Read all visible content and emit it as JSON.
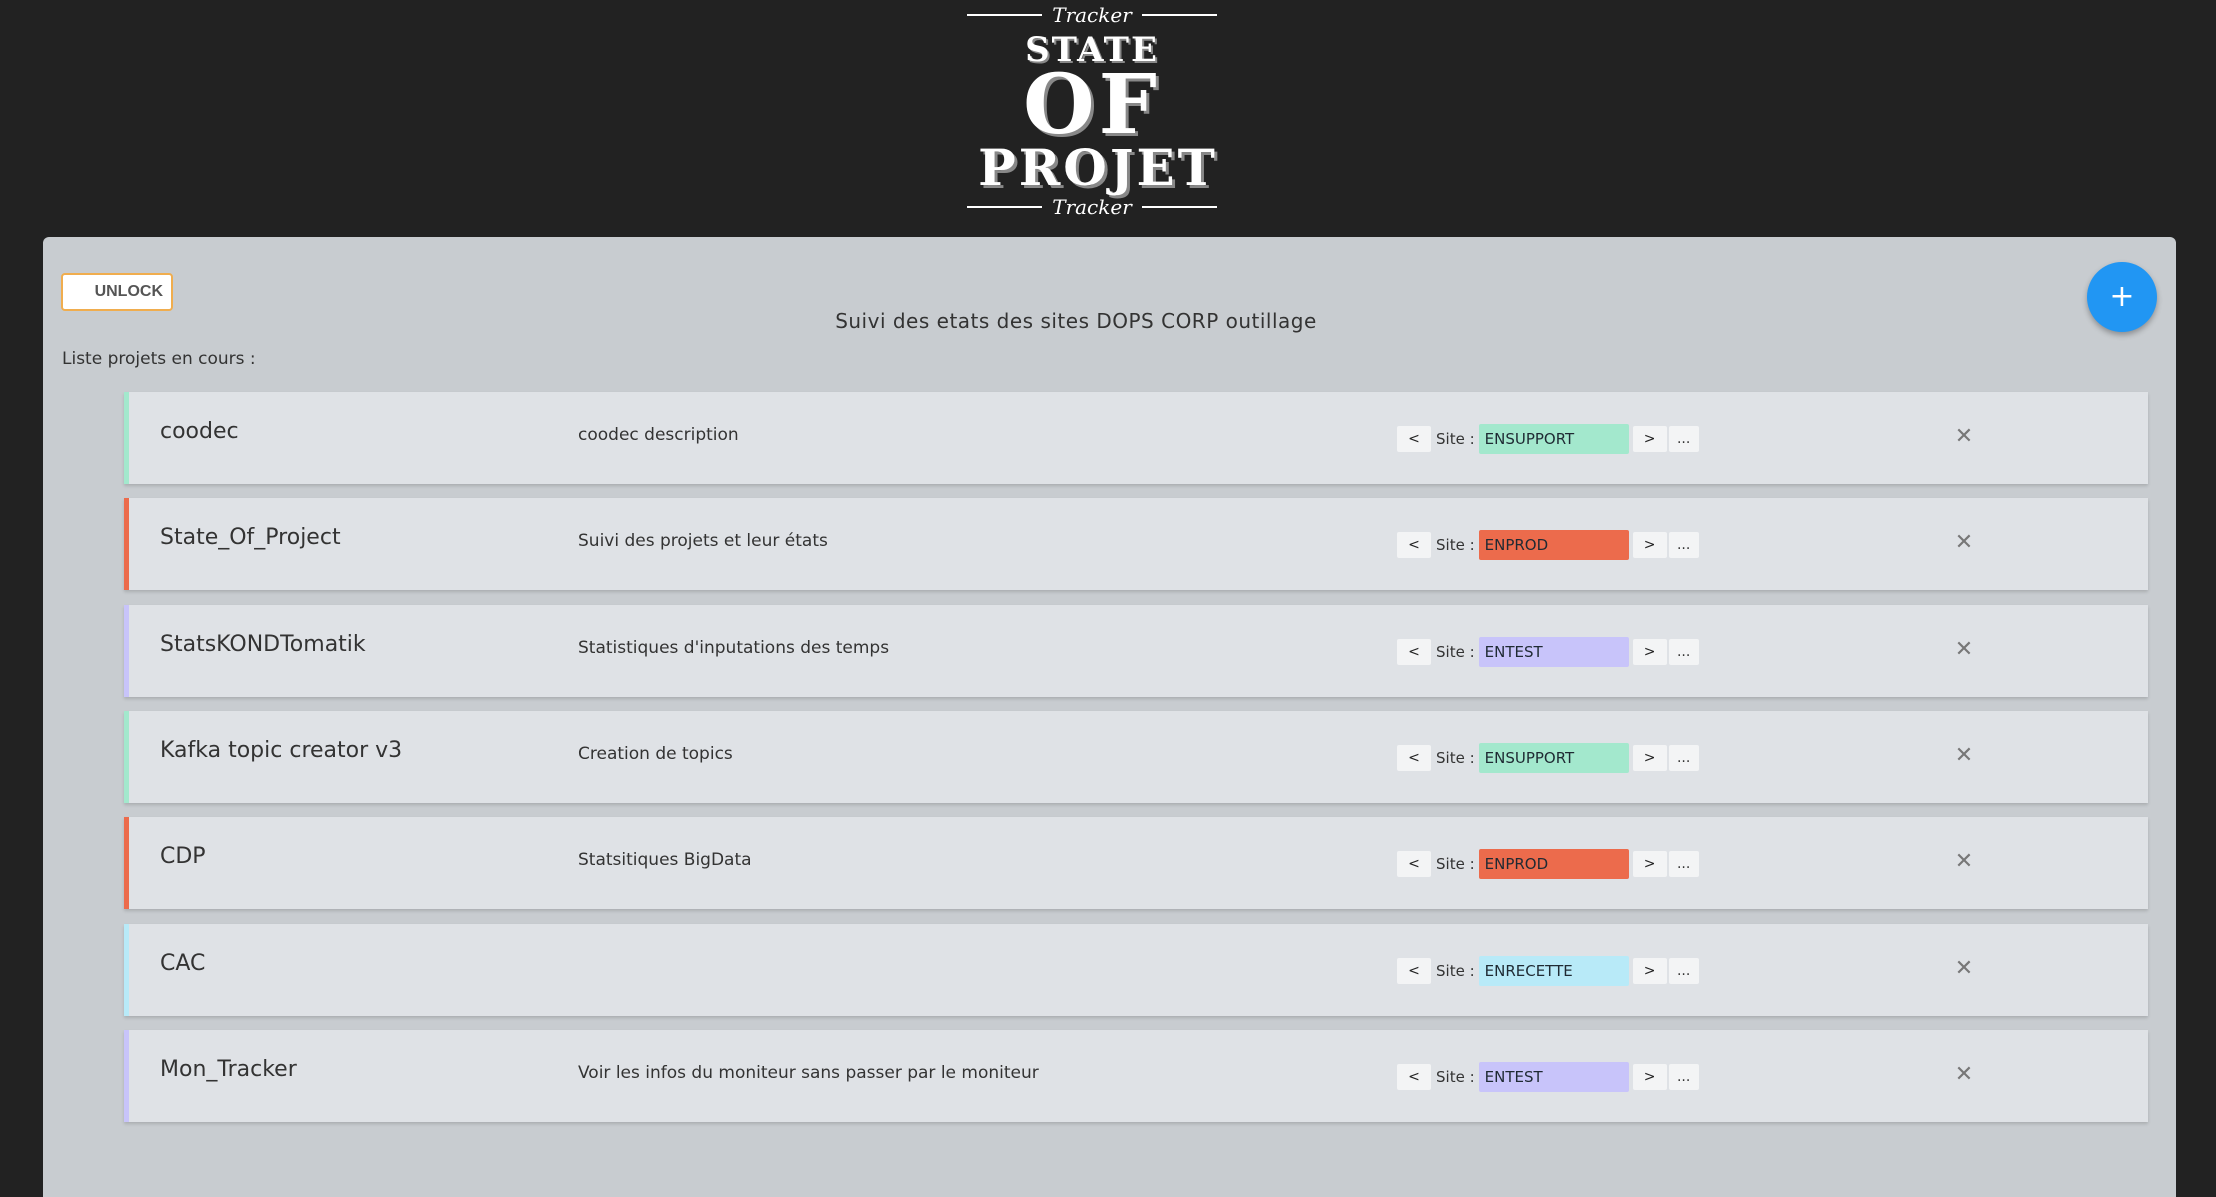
{
  "logo": {
    "top_word": "Tracker",
    "line1": "STATE",
    "line2": "OF",
    "line3": "PROJET",
    "bottom_word": "Tracker"
  },
  "toolbar": {
    "unlock_label": "UNLOCK",
    "add_label": "+"
  },
  "page_title": "Suivi des etats des sites DOPS CORP outillage",
  "list_label": "Liste projets en cours :",
  "site_label": "Site :",
  "prev_label": "<",
  "next_label": ">",
  "more_label": "...",
  "delete_label": "✕",
  "state_colors": {
    "ENSUPPORT": "#a3e8cd",
    "ENPROD": "#ec6b4c",
    "ENTEST": "#c8c4fa",
    "ENRECETTE": "#b8eaf8"
  },
  "projects": [
    {
      "name": "coodec",
      "description": "coodec description",
      "state": "ENSUPPORT"
    },
    {
      "name": "State_Of_Project",
      "description": "Suivi des projets et leur états",
      "state": "ENPROD"
    },
    {
      "name": "StatsKONDTomatik",
      "description": "Statistiques d'inputations des temps",
      "state": "ENTEST"
    },
    {
      "name": "Kafka topic creator v3",
      "description": "Creation de topics",
      "state": "ENSUPPORT"
    },
    {
      "name": "CDP",
      "description": "Statsitiques BigData",
      "state": "ENPROD"
    },
    {
      "name": "CAC",
      "description": "",
      "state": "ENRECETTE"
    },
    {
      "name": "Mon_Tracker",
      "description": "Voir les infos du moniteur sans passer par le moniteur",
      "state": "ENTEST"
    }
  ]
}
